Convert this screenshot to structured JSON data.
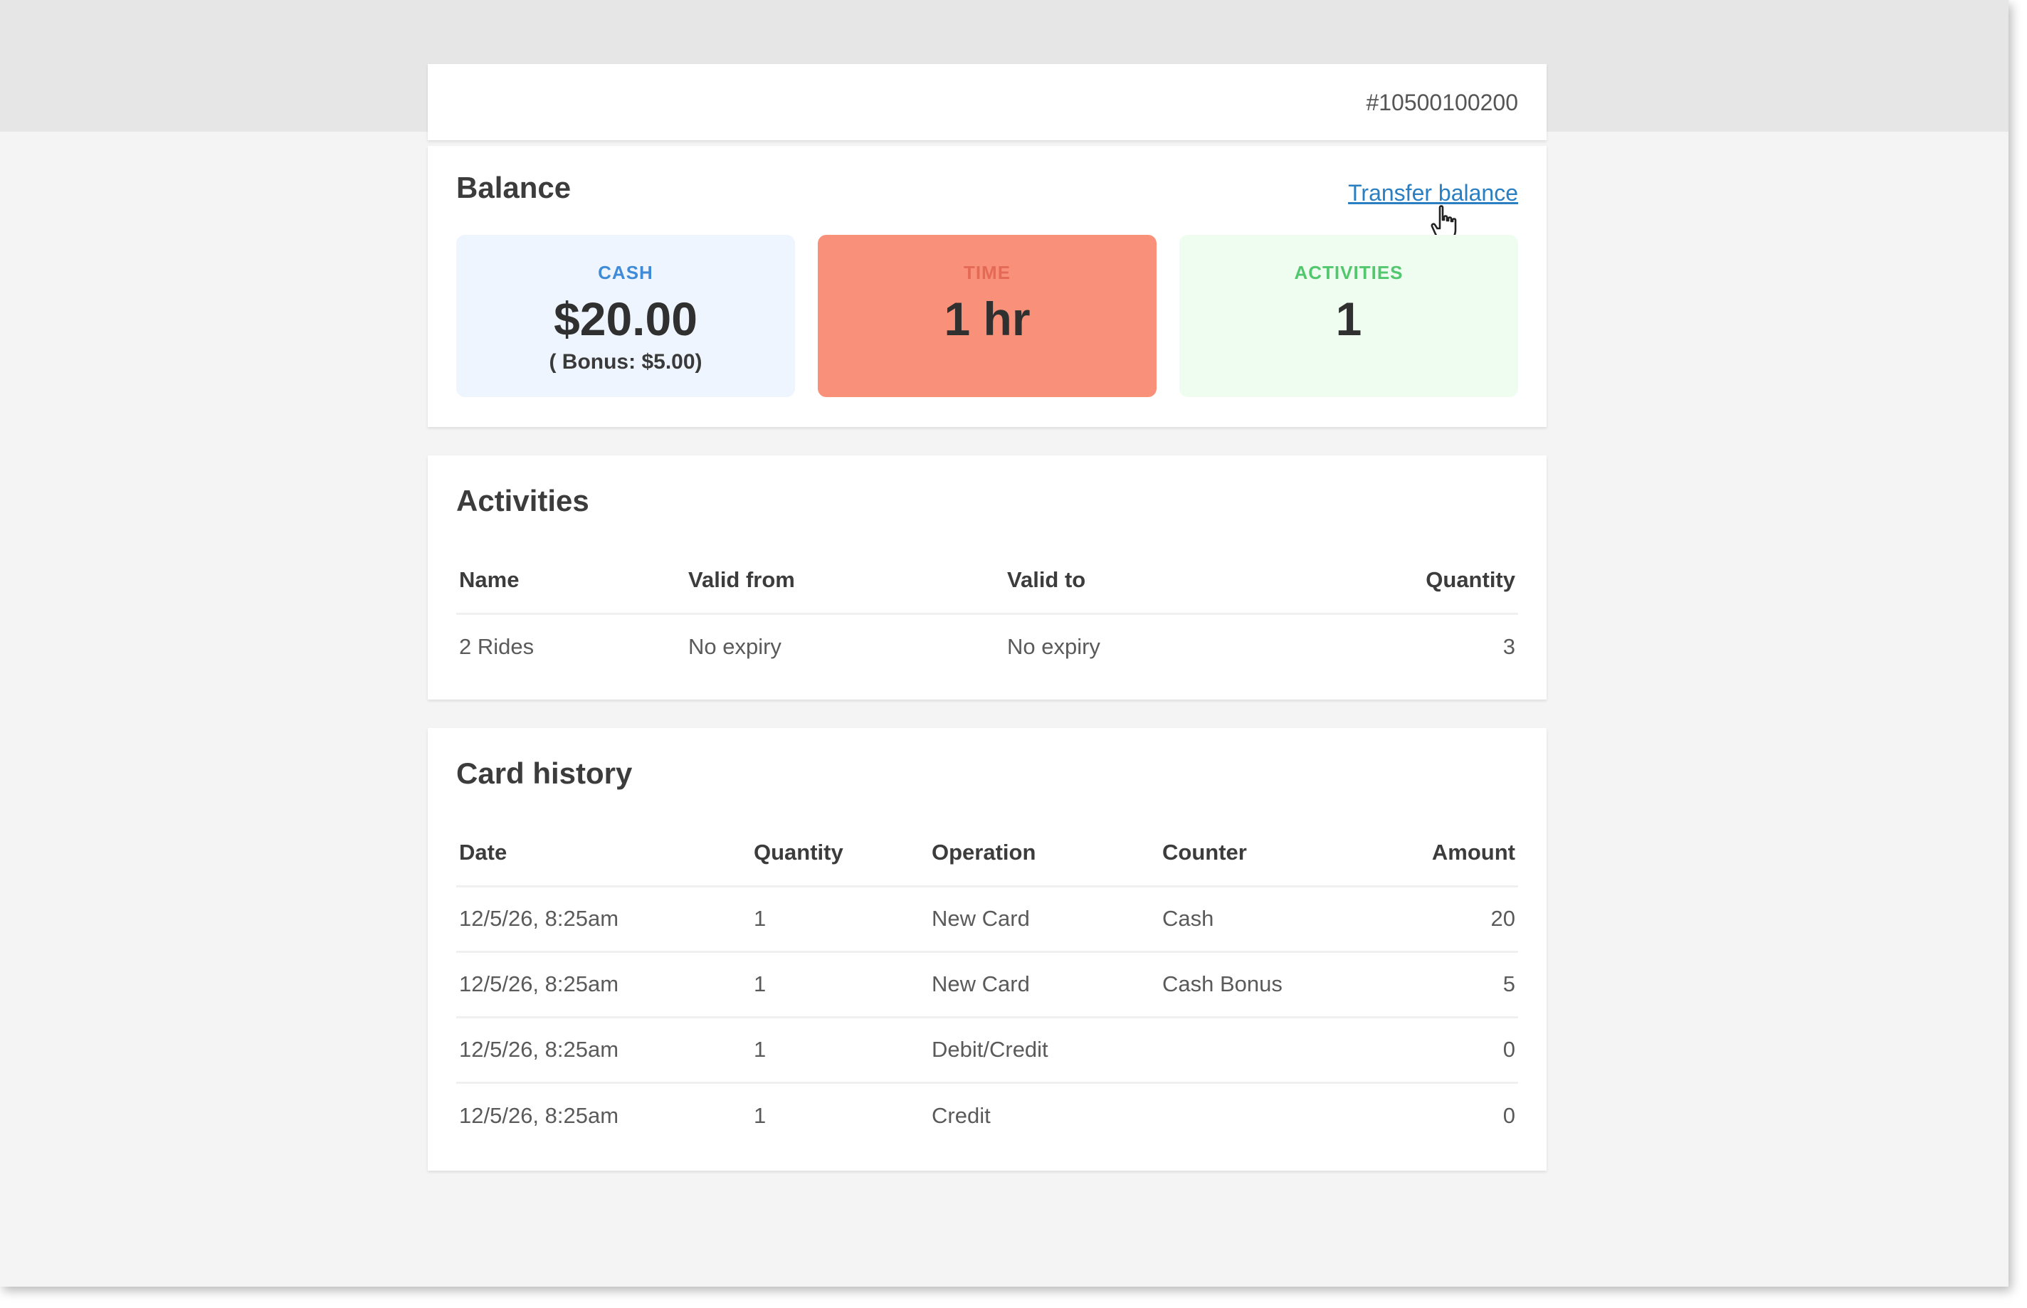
{
  "card": {
    "number": "#10500100200"
  },
  "balance": {
    "title": "Balance",
    "transfer_label": "Transfer balance",
    "cash": {
      "label": "CASH",
      "value": "$20.00",
      "bonus": "( Bonus: $5.00)"
    },
    "time": {
      "label": "TIME",
      "value": "1 hr"
    },
    "activities": {
      "label": "ACTIVITIES",
      "value": "1"
    }
  },
  "activities": {
    "title": "Activities",
    "columns": [
      "Name",
      "Valid from",
      "Valid to",
      "Quantity"
    ],
    "rows": [
      {
        "name": "2 Rides",
        "valid_from": "No expiry",
        "valid_to": "No expiry",
        "quantity": "3"
      }
    ]
  },
  "history": {
    "title": "Card history",
    "columns": [
      "Date",
      "Quantity",
      "Operation",
      "Counter",
      "Amount"
    ],
    "rows": [
      {
        "date": "12/5/26, 8:25am",
        "quantity": "1",
        "operation": "New Card",
        "counter": "Cash",
        "amount": "20"
      },
      {
        "date": "12/5/26, 8:25am",
        "quantity": "1",
        "operation": "New Card",
        "counter": "Cash Bonus",
        "amount": "5"
      },
      {
        "date": "12/5/26, 8:25am",
        "quantity": "1",
        "operation": "Debit/Credit",
        "counter": "",
        "amount": "0"
      },
      {
        "date": "12/5/26, 8:25am",
        "quantity": "1",
        "operation": "Credit",
        "counter": "",
        "amount": "0"
      }
    ]
  },
  "colors": {
    "link": "#2a7ec2",
    "cash_tile": "#eef5fe",
    "time_tile": "#f99079",
    "activities_tile": "#effdf1"
  },
  "icons": {
    "cursor": "hand-pointer-icon"
  }
}
